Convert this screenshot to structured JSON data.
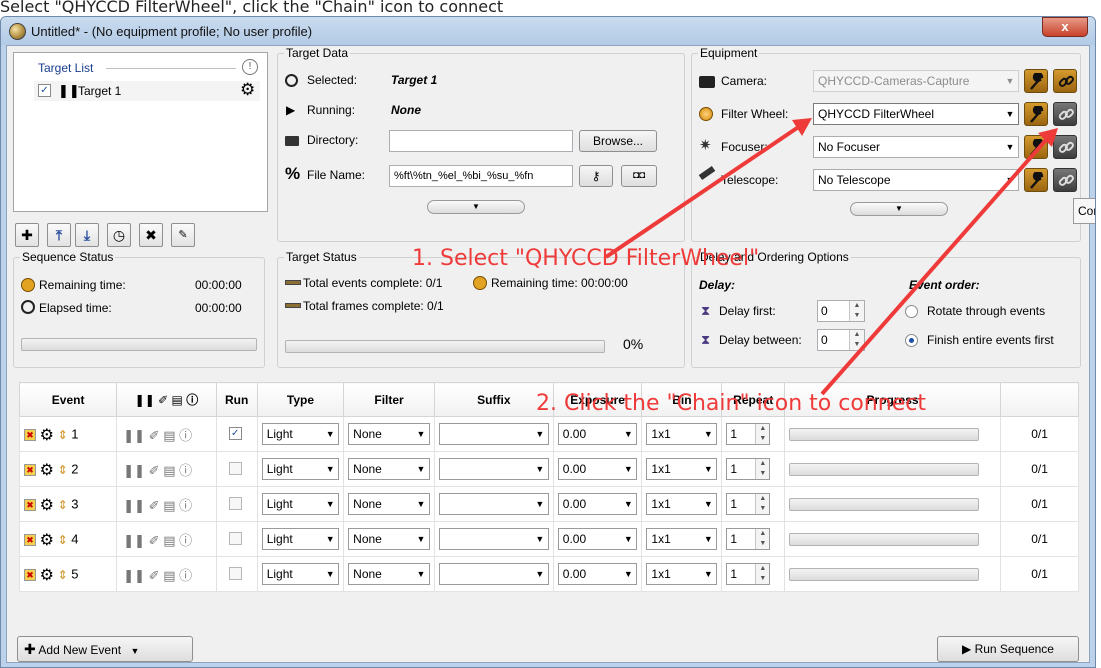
{
  "caption": "Select \"QHYCCD FilterWheel\", click the \"Chain\" icon to connect",
  "window": {
    "title": "Untitled* - (No equipment profile; No user profile)",
    "close_label": "x"
  },
  "target_list": {
    "legend": "Target List",
    "items": [
      {
        "label": "Target 1"
      }
    ]
  },
  "target_data": {
    "legend": "Target Data",
    "selected_label": "Selected:",
    "selected_value": "Target 1",
    "running_label": "Running:",
    "running_value": "None",
    "directory_label": "Directory:",
    "directory_value": "",
    "browse_label": "Browse...",
    "filename_label": "File Name:",
    "filename_value": "%ft\\%tn_%el_%bi_%su_%fn"
  },
  "equipment": {
    "legend": "Equipment",
    "camera_label": "Camera:",
    "camera_value": "QHYCCD-Cameras-Capture",
    "filter_label": "Filter Wheel:",
    "filter_value": "QHYCCD FilterWheel",
    "focuser_label": "Focuser:",
    "focuser_value": "No Focuser",
    "telescope_label": "Telescope:",
    "telescope_value": "No Telescope"
  },
  "tooltip": "Connect",
  "sequence_status": {
    "legend": "Sequence Status",
    "remaining_label": "Remaining time:",
    "remaining_value": "00:00:00",
    "elapsed_label": "Elapsed time:",
    "elapsed_value": "00:00:00"
  },
  "target_status": {
    "legend": "Target Status",
    "events_text": "Total events complete: 0/1",
    "remaining_text": "Remaining time: 00:00:00",
    "frames_text": "Total frames complete: 0/1",
    "percent": "0%",
    "progress": 0
  },
  "delay": {
    "legend": "Delay and Ordering Options",
    "delay_title": "Delay:",
    "delay_first_label": "Delay first:",
    "delay_first_value": "0",
    "delay_between_label": "Delay between:",
    "delay_between_value": "0",
    "order_title": "Event order:",
    "rotate_label": "Rotate through events",
    "finish_label": "Finish entire events first",
    "selected_order": "finish"
  },
  "table": {
    "headers": {
      "event": "Event",
      "run": "Run",
      "type": "Type",
      "filter": "Filter",
      "suffix": "Suffix",
      "exposure": "Exposure",
      "bin": "Bin",
      "repeat": "Repeat",
      "progress": "Progress"
    },
    "rows": [
      {
        "num": "1",
        "run": true,
        "type": "Light",
        "filter": "None",
        "suffix": "",
        "exposure": "0.00",
        "bin": "1x1",
        "repeat": "1",
        "progress": "0/1"
      },
      {
        "num": "2",
        "run": false,
        "type": "Light",
        "filter": "None",
        "suffix": "",
        "exposure": "0.00",
        "bin": "1x1",
        "repeat": "1",
        "progress": "0/1"
      },
      {
        "num": "3",
        "run": false,
        "type": "Light",
        "filter": "None",
        "suffix": "",
        "exposure": "0.00",
        "bin": "1x1",
        "repeat": "1",
        "progress": "0/1"
      },
      {
        "num": "4",
        "run": false,
        "type": "Light",
        "filter": "None",
        "suffix": "",
        "exposure": "0.00",
        "bin": "1x1",
        "repeat": "1",
        "progress": "0/1"
      },
      {
        "num": "5",
        "run": false,
        "type": "Light",
        "filter": "None",
        "suffix": "",
        "exposure": "0.00",
        "bin": "1x1",
        "repeat": "1",
        "progress": "0/1"
      }
    ]
  },
  "footer": {
    "add_event_label": "Add New Event",
    "run_sequence_label": "Run Sequence"
  },
  "annotations": {
    "step1": "1. Select \"QHYCCD FilterWheel\"",
    "step2": "2. Click the \"Chain\" icon to connect"
  },
  "colors": {
    "annotation": "#ef3a3a",
    "accent_orange": "#c7861e"
  }
}
